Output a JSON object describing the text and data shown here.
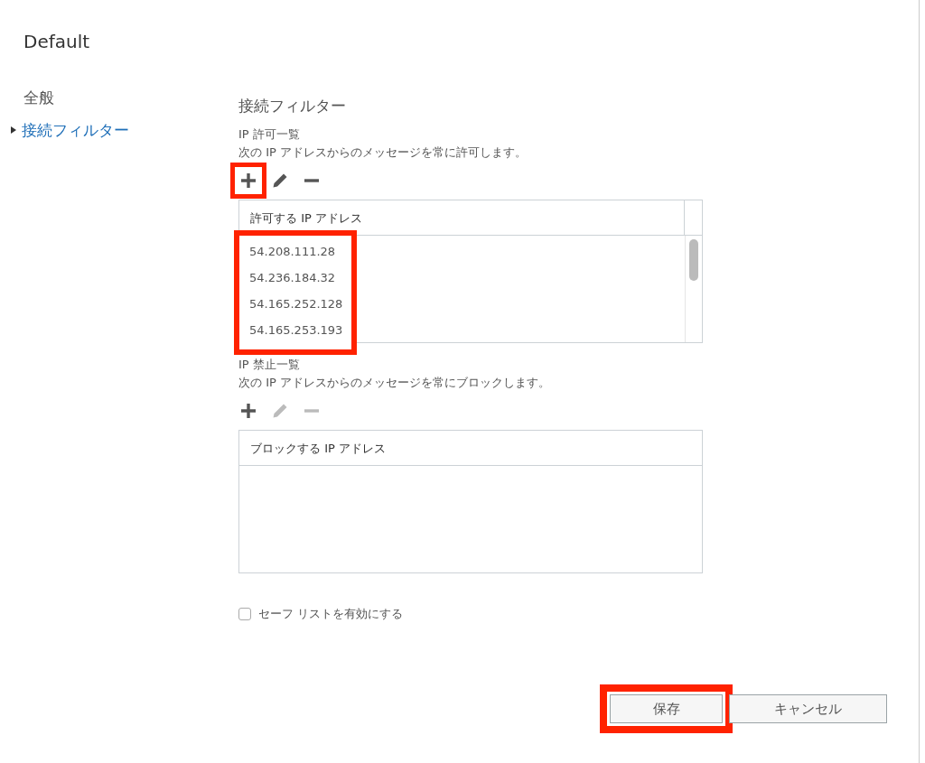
{
  "window": {
    "title": "Default"
  },
  "sidebar": {
    "items": [
      {
        "label": "全般",
        "selected": false
      },
      {
        "label": "接続フィルター",
        "selected": true
      }
    ]
  },
  "section": {
    "heading": "接続フィルター"
  },
  "lists": [
    {
      "title": "IP 許可一覧",
      "description": "次の IP アドレスからのメッセージを常に許可します。",
      "toolbar": [
        {
          "kind": "add",
          "disabled": false,
          "highlighted": true
        },
        {
          "kind": "edit",
          "disabled": false,
          "highlighted": false
        },
        {
          "kind": "remove",
          "disabled": false,
          "highlighted": false
        }
      ],
      "column": "許可する IP アドレス",
      "rows_highlighted": true,
      "scrollbar": true,
      "rows": [
        "54.208.111.28",
        "54.236.184.32",
        "54.165.252.128",
        "54.165.253.193"
      ]
    },
    {
      "title": "IP 禁止一覧",
      "description": "次の IP アドレスからのメッセージを常にブロックします。",
      "toolbar": [
        {
          "kind": "add",
          "disabled": false,
          "highlighted": false
        },
        {
          "kind": "edit",
          "disabled": true,
          "highlighted": false
        },
        {
          "kind": "remove",
          "disabled": true,
          "highlighted": false
        }
      ],
      "column": "ブロックする IP アドレス",
      "rows_highlighted": false,
      "scrollbar": false
    }
  ],
  "safe_list": {
    "label": "セーフ リストを有効にする",
    "checked": false
  },
  "buttons": [
    {
      "label": "保存",
      "highlighted": true
    },
    {
      "label": "キャンセル",
      "highlighted": false
    }
  ]
}
